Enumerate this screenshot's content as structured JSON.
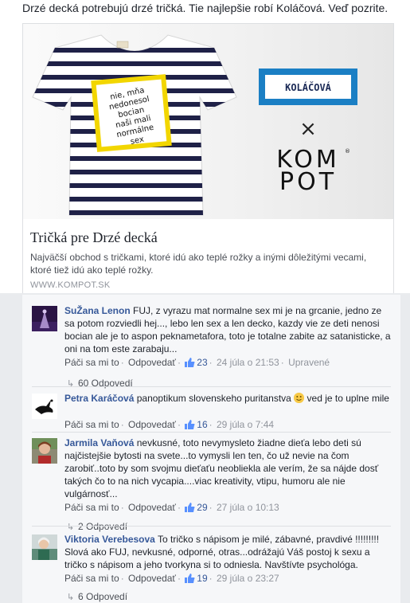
{
  "post": {
    "intro_text": "Drzé decká potrebujú drzé tričká. Tie najlepšie robí Koláčová. Veď pozrite.",
    "card": {
      "tshirt_print_lines": [
        "nie, mňa",
        "nedonesol",
        "bocian",
        "naši mali",
        "normálne",
        "sex"
      ],
      "brand_label": "KOLÁČOVÁ",
      "cross_symbol": "×",
      "kompot_line1": "KOM",
      "kompot_line2": "POT",
      "kompot_reg": "®",
      "title": "Tričká pre Drzé decká",
      "description": "Najväčší obchod s tričkami, ktoré idú ako teplé rožky a inými dôležitými vecami, ktoré tiež idú ako teplé rožky.",
      "domain": "WWW.KOMPOT.SK"
    }
  },
  "comments": [
    {
      "author": "SuŽana Lenon",
      "text": "FUJ, z vyrazu mat normalne sex mi je na grcanie, jedno ze sa potom rozviedli hej..., lebo len sex a len decko, kazdy vie ze deti nenosi bocian ale je to aspon peknametafora, toto je totalne zabite az satanisticke, a oni na tom este zarabaju...",
      "like": "Páči sa mi to",
      "reply": "Odpovedať",
      "likes": "23",
      "time": "24 júla o 21:53",
      "edited": "Upravené",
      "replies_label": "60 Odpovedí"
    },
    {
      "author": "Petra Karáčová",
      "text": "panoptikum slovenskeho puritanstva",
      "text_after": "ved je to uplne mile",
      "like": "Páči sa mi to",
      "reply": "Odpovedať",
      "likes": "16",
      "time": "29 júla o 7:44"
    },
    {
      "author": "Jarmila Vaňová",
      "text": "nevkusné, toto nevymysleto žiadne dieťa lebo deti sú najčistejšie bytosti na svete...to vymysli len ten, čo už nevie na čom zarobiť..toto by som svojmu dieťaťu neobliekla ale verím, že sa nájde dosť takých čo to na nich vycapia....viac kreativity, vtipu, humoru ale nie vulgárnosť...",
      "like": "Páči sa mi to",
      "reply": "Odpovedať",
      "likes": "29",
      "time": "27 júla o 10:13",
      "replies_label": "2 Odpovedí"
    },
    {
      "author": "Viktoria Verebesova",
      "text": "To tričko s nápisom je milé, zábavné, pravdivé !!!!!!!!! Slová ako FUJ, nevkusné, odporné, otras...odrážajú Váš postoj k sexu a tričko s nápisom a jeho tvorkyna si to odniesla. Navštívte psychológa.",
      "like": "Páči sa mi to",
      "reply": "Odpovedať",
      "likes": "19",
      "time": "29 júla o 23:27",
      "replies_label": "6 Odpovedí"
    }
  ],
  "colors": {
    "link": "#365899",
    "meta": "#90949c",
    "brand_blue": "#1b7fc4"
  },
  "icons": [
    "like-icon",
    "reply-arrow-icon",
    "smile-emoji-icon"
  ]
}
